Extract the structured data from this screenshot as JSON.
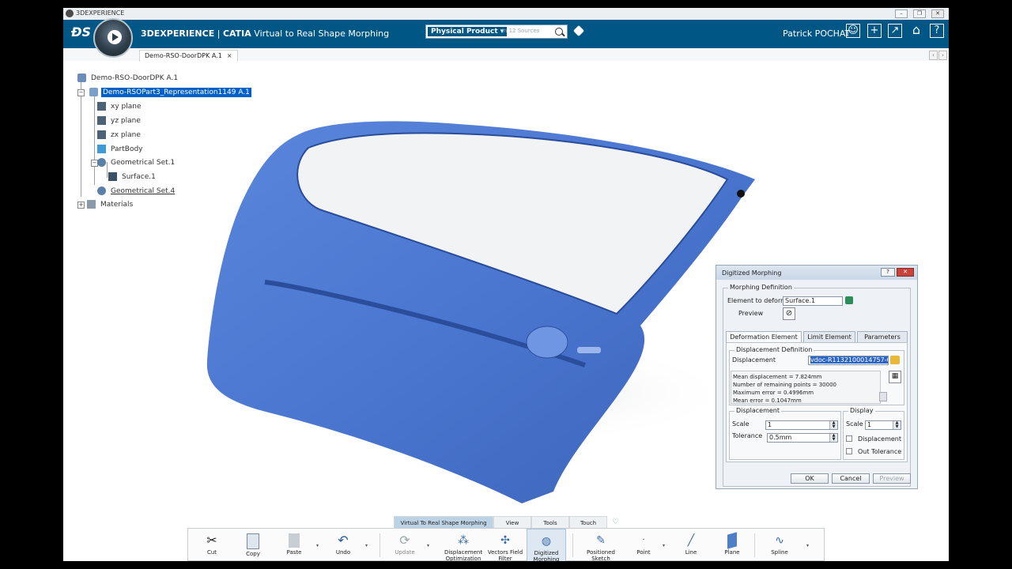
{
  "window": {
    "title": "3DEXPERIENCE"
  },
  "header": {
    "brand": "3DEXPERIENCE",
    "app_prefix": "CATIA",
    "app_name": "Virtual to Real Shape Morphing",
    "search_scope": "Physical Product",
    "search_placeholder": "in 12 Sources",
    "user": "Patrick POCHAT"
  },
  "document": {
    "tab": "Demo-RSO-DoorDPK A.1"
  },
  "tree": {
    "items": [
      {
        "label": "Demo-RSO-DoorDPK A.1"
      },
      {
        "label": "Demo-RSOPart3_Representation1149 A.1"
      },
      {
        "label": "xy plane"
      },
      {
        "label": "yz plane"
      },
      {
        "label": "zx plane"
      },
      {
        "label": "PartBody"
      },
      {
        "label": "Geometrical Set.1"
      },
      {
        "label": "Surface.1"
      },
      {
        "label": "Geometrical Set.4"
      },
      {
        "label": "Materials"
      }
    ]
  },
  "dialog": {
    "title": "Digitized Morphing",
    "morphing_definition": "Morphing Definition",
    "element_label": "Element to deform",
    "element_value": "Surface.1",
    "preview_label": "Preview",
    "tabs": [
      "Deformation Element",
      "Limit Element",
      "Parameters"
    ],
    "displacement_definition": "Displacement Definition",
    "displacement_label": "Displacement",
    "displacement_value": "vdoc-R1132100014757-0000",
    "stats": [
      "Mean displacement = 7.824mm",
      "Number of remaining points = 30000",
      "Maximum error = 0.4996mm",
      "Mean error = 0.1047mm"
    ],
    "disp_group": "Displacement",
    "scale_label": "Scale",
    "scale_value": "1",
    "tolerance_label": "Tolerance",
    "tolerance_value": "0.5mm",
    "display_group": "Display",
    "display_scale_label": "Scale",
    "display_scale_value": "1",
    "chk_displacement": "Displacement",
    "chk_out_tolerance": "Out Tolerance",
    "ok": "OK",
    "cancel": "Cancel",
    "preview_btn": "Preview"
  },
  "actionbar": {
    "tabs": [
      "Virtual To Real Shape Morphing",
      "View",
      "Tools",
      "Touch"
    ],
    "tools": [
      {
        "label": "Cut"
      },
      {
        "label": "Copy"
      },
      {
        "label": "Paste"
      },
      {
        "label": "Undo"
      },
      {
        "label": "Update"
      },
      {
        "label": "Displacement Optimization"
      },
      {
        "label": "Vectors Field Filter"
      },
      {
        "label": "Digitized Morphing"
      },
      {
        "label": "Positioned Sketch"
      },
      {
        "label": "Point"
      },
      {
        "label": "Line"
      },
      {
        "label": "Plane"
      },
      {
        "label": "Spline"
      }
    ]
  },
  "colors": {
    "header": "#005685",
    "door": "#4a76d0",
    "selection": "#0060c8"
  }
}
